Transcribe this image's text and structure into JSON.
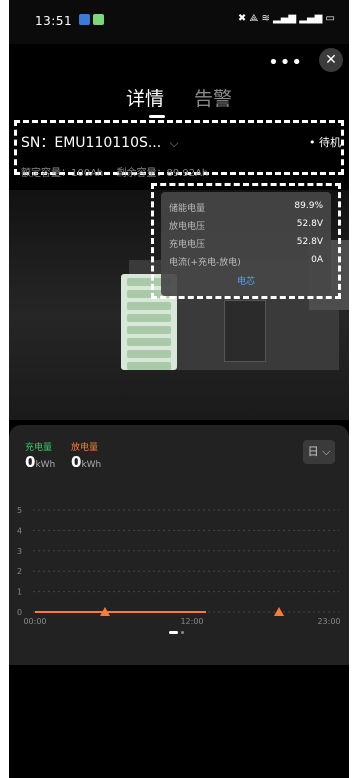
{
  "status": {
    "time": "13:51",
    "icons": "✖ ⟁ ≋ ▂▄▆ ▂▄▆ ▭"
  },
  "topbar": {
    "more": "•••",
    "close": "✕"
  },
  "tabs": [
    {
      "label": "详情"
    },
    {
      "label": "告警"
    }
  ],
  "device": {
    "sn": "SN：EMU110110S...",
    "chevron": "⌵",
    "state": "• 待机",
    "rated": "额定容量：100Ah",
    "remaining": "剩余容量：89.92Ah"
  },
  "info": {
    "rows": [
      {
        "label": "储能电量",
        "value": "89.9%"
      },
      {
        "label": "放电电压",
        "value": "52.8V"
      },
      {
        "label": "充电电压",
        "value": "52.8V"
      },
      {
        "label": "电流(+充电-放电)",
        "value": "0A"
      }
    ],
    "link": "电芯"
  },
  "energy": {
    "charge_label": "充电量",
    "charge_value": "0",
    "charge_unit": "kWh",
    "discharge_label": "放电量",
    "discharge_value": "0",
    "discharge_unit": "kWh",
    "period": "日 ⌵"
  },
  "colors": {
    "charge": "#33cc66",
    "discharge": "#ff7a33",
    "link": "#5aa0ff"
  },
  "chart_data": {
    "type": "line",
    "x": [
      "00:00",
      "12:00",
      "23:00"
    ],
    "yticks": [
      0,
      1,
      2,
      3,
      4,
      5
    ],
    "ylim": [
      0,
      5
    ],
    "series": [
      {
        "values": [
          0,
          0
        ]
      }
    ],
    "grid": true
  }
}
